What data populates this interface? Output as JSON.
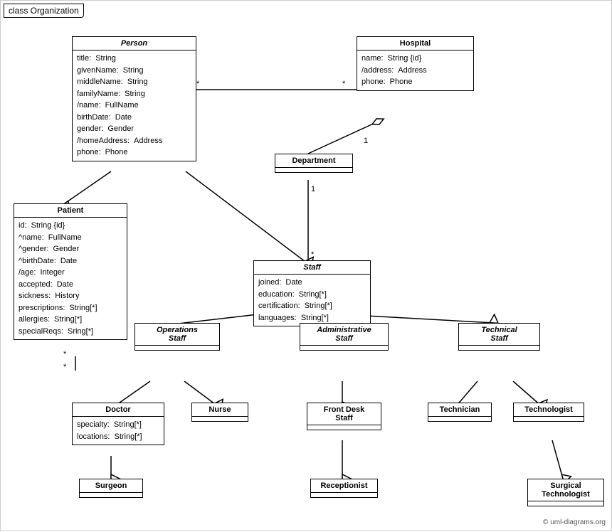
{
  "title": "class Organization",
  "classes": {
    "person": {
      "name": "Person",
      "italic": true,
      "attrs": [
        {
          "name": "title:",
          "type": "String"
        },
        {
          "name": "givenName:",
          "type": "String"
        },
        {
          "name": "middleName:",
          "type": "String"
        },
        {
          "name": "familyName:",
          "type": "String"
        },
        {
          "name": "/name:",
          "type": "FullName"
        },
        {
          "name": "birthDate:",
          "type": "Date"
        },
        {
          "name": "gender:",
          "type": "Gender"
        },
        {
          "name": "/homeAddress:",
          "type": "Address"
        },
        {
          "name": "phone:",
          "type": "Phone"
        }
      ]
    },
    "hospital": {
      "name": "Hospital",
      "italic": false,
      "attrs": [
        {
          "name": "name:",
          "type": "String {id}"
        },
        {
          "name": "/address:",
          "type": "Address"
        },
        {
          "name": "phone:",
          "type": "Phone"
        }
      ]
    },
    "department": {
      "name": "Department",
      "italic": false,
      "attrs": []
    },
    "staff": {
      "name": "Staff",
      "italic": true,
      "attrs": [
        {
          "name": "joined:",
          "type": "Date"
        },
        {
          "name": "education:",
          "type": "String[*]"
        },
        {
          "name": "certification:",
          "type": "String[*]"
        },
        {
          "name": "languages:",
          "type": "String[*]"
        }
      ]
    },
    "patient": {
      "name": "Patient",
      "italic": false,
      "attrs": [
        {
          "name": "id:",
          "type": "String {id}"
        },
        {
          "name": "^name:",
          "type": "FullName"
        },
        {
          "name": "^gender:",
          "type": "Gender"
        },
        {
          "name": "^birthDate:",
          "type": "Date"
        },
        {
          "name": "/age:",
          "type": "Integer"
        },
        {
          "name": "accepted:",
          "type": "Date"
        },
        {
          "name": "sickness:",
          "type": "History"
        },
        {
          "name": "prescriptions:",
          "type": "String[*]"
        },
        {
          "name": "allergies:",
          "type": "String[*]"
        },
        {
          "name": "specialReqs:",
          "type": "Sring[*]"
        }
      ]
    },
    "operations_staff": {
      "name": "Operations Staff",
      "italic": true,
      "attrs": []
    },
    "administrative_staff": {
      "name": "Administrative Staff",
      "italic": true,
      "attrs": []
    },
    "technical_staff": {
      "name": "Technical Staff",
      "italic": true,
      "attrs": []
    },
    "doctor": {
      "name": "Doctor",
      "italic": false,
      "attrs": [
        {
          "name": "specialty:",
          "type": "String[*]"
        },
        {
          "name": "locations:",
          "type": "String[*]"
        }
      ]
    },
    "nurse": {
      "name": "Nurse",
      "italic": false,
      "attrs": []
    },
    "front_desk_staff": {
      "name": "Front Desk Staff",
      "italic": false,
      "attrs": []
    },
    "technician": {
      "name": "Technician",
      "italic": false,
      "attrs": []
    },
    "technologist": {
      "name": "Technologist",
      "italic": false,
      "attrs": []
    },
    "surgeon": {
      "name": "Surgeon",
      "italic": false,
      "attrs": []
    },
    "receptionist": {
      "name": "Receptionist",
      "italic": false,
      "attrs": []
    },
    "surgical_technologist": {
      "name": "Surgical Technologist",
      "italic": false,
      "attrs": []
    }
  },
  "copyright": "© uml-diagrams.org"
}
